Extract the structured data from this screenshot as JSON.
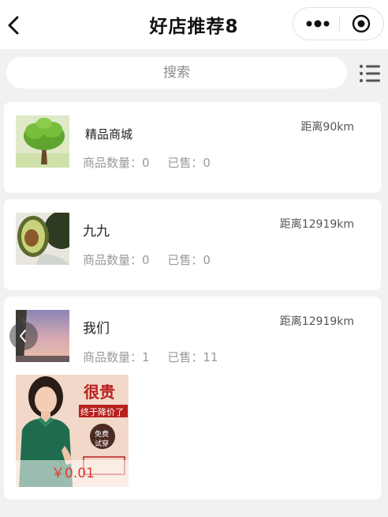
{
  "header": {
    "title": "好店推荐8"
  },
  "search": {
    "placeholder": "搜索"
  },
  "shops": [
    {
      "name": "精品商城",
      "distance": "距离90km",
      "product_count": "商品数量：0",
      "sold": "已售：0"
    },
    {
      "name": "九九",
      "distance": "距离12919km",
      "product_count": "商品数量：0",
      "sold": "已售：0"
    },
    {
      "name": "我们",
      "distance": "距离12919km",
      "product_count": "商品数量：1",
      "sold": "已售：11",
      "products": [
        {
          "price": "￥0.01",
          "banner_lines": [
            "很贵",
            "终于降价了",
            "免费",
            "试穿"
          ]
        }
      ]
    }
  ],
  "icons": {
    "back": "chevron-left-icon",
    "more": "more-dots-icon",
    "close_mini": "target-icon",
    "list": "list-icon",
    "scroll": "chevron-left-icon"
  },
  "colors": {
    "price": "#e0392b",
    "banner_red": "#b8201e",
    "shirt_green": "#1f6b4e"
  }
}
